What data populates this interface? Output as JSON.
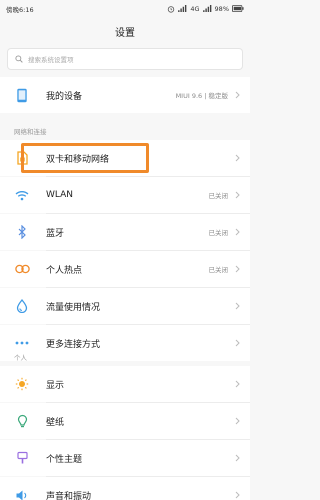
{
  "status_bar": {
    "time": "傍晚6:16",
    "network": "4G",
    "battery": "98%"
  },
  "header": {
    "title": "设置"
  },
  "search": {
    "placeholder": "搜索系统设置项"
  },
  "device_row": {
    "label": "我的设备",
    "value": "MIUI 9.6 | 稳定版"
  },
  "sections": {
    "network": "网络和连接",
    "personal": "个人"
  },
  "network_items": [
    {
      "label": "双卡和移动网络",
      "value": "",
      "icon": "sim-card-icon"
    },
    {
      "label": "WLAN",
      "value": "已关闭",
      "icon": "wifi-icon"
    },
    {
      "label": "蓝牙",
      "value": "已关闭",
      "icon": "bluetooth-icon"
    },
    {
      "label": "个人热点",
      "value": "已关闭",
      "icon": "hotspot-icon"
    },
    {
      "label": "流量使用情况",
      "value": "",
      "icon": "data-usage-icon"
    },
    {
      "label": "更多连接方式",
      "value": "",
      "icon": "more-icon"
    }
  ],
  "personal_items": [
    {
      "label": "显示",
      "icon": "display-icon"
    },
    {
      "label": "壁纸",
      "icon": "wallpaper-icon"
    },
    {
      "label": "个性主题",
      "icon": "theme-icon"
    },
    {
      "label": "声音和振动",
      "icon": "sound-icon"
    }
  ],
  "colors": {
    "highlight": "#f08a2a",
    "accent_blue": "#3f9be6",
    "accent_orange": "#f5a623"
  }
}
